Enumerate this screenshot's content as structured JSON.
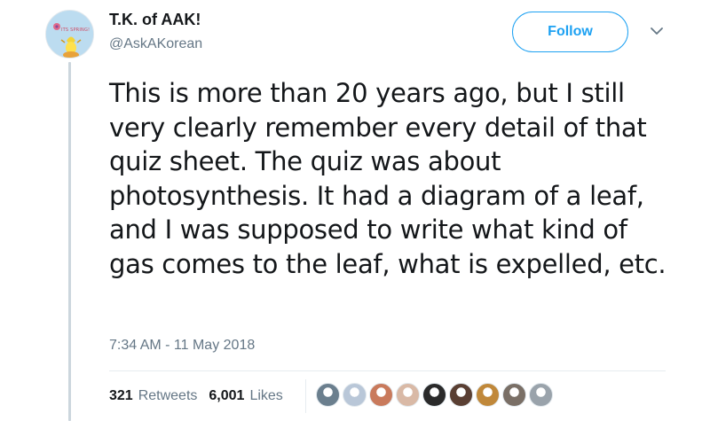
{
  "user": {
    "display_name": "T.K. of AAK!",
    "handle": "@AskAKorean",
    "avatar_text": "ITS SPRING!"
  },
  "actions": {
    "follow_label": "Follow"
  },
  "tweet": {
    "text": "This is more than 20 years ago, but I still very clearly remember every detail of that quiz sheet. The quiz was about photosynthesis. It had a diagram of a leaf, and I was supposed to write what kind of gas comes to the leaf, what is expelled, etc.",
    "timestamp": "7:34 AM - 11 May 2018"
  },
  "stats": {
    "retweets_count": "321",
    "retweets_label": "Retweets",
    "likes_count": "6,001",
    "likes_label": "Likes"
  },
  "likers": [
    {
      "color": "#6b7f8e"
    },
    {
      "color": "#b9c7d8"
    },
    {
      "color": "#c97a5c"
    },
    {
      "color": "#d9b9a6"
    },
    {
      "color": "#2a2a2a"
    },
    {
      "color": "#5a3f33"
    },
    {
      "color": "#c0883a"
    },
    {
      "color": "#7a6f66"
    },
    {
      "color": "#9aa3ab"
    }
  ],
  "colors": {
    "accent": "#1da1f2",
    "text": "#14171a",
    "muted": "#657786"
  }
}
